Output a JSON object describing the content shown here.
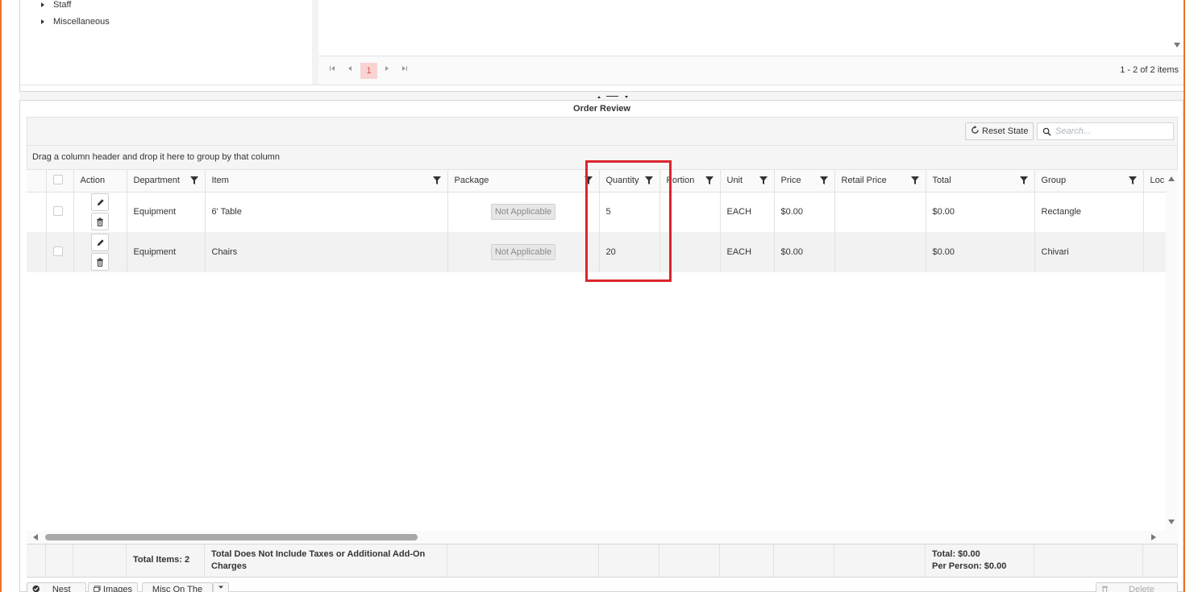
{
  "tree": {
    "items": [
      {
        "label": "Staff"
      },
      {
        "label": "Miscellaneous"
      }
    ]
  },
  "top_pager": {
    "first_icon": "first-page-icon",
    "prev_icon": "prev-page-icon",
    "current_page": "1",
    "next_icon": "next-page-icon",
    "last_icon": "last-page-icon",
    "info": "1 - 2 of 2 items"
  },
  "review": {
    "title": "Order Review",
    "reset_label": "Reset State",
    "search_placeholder": "Search...",
    "group_hint": "Drag a column header and drop it here to group by that column"
  },
  "columns": [
    {
      "key": "select",
      "label": "",
      "filter": false
    },
    {
      "key": "action",
      "label": "Action",
      "filter": false
    },
    {
      "key": "department",
      "label": "Department",
      "filter": true
    },
    {
      "key": "item",
      "label": "Item",
      "filter": true
    },
    {
      "key": "package",
      "label": "Package",
      "filter": true
    },
    {
      "key": "quantity",
      "label": "Quantity",
      "filter": true
    },
    {
      "key": "portion",
      "label": "Portion",
      "filter": true
    },
    {
      "key": "unit",
      "label": "Unit",
      "filter": true
    },
    {
      "key": "price",
      "label": "Price",
      "filter": true
    },
    {
      "key": "retail_price",
      "label": "Retail Price",
      "filter": true
    },
    {
      "key": "total",
      "label": "Total",
      "filter": true
    },
    {
      "key": "group",
      "label": "Group",
      "filter": true
    },
    {
      "key": "location",
      "label": "Loc",
      "filter": false
    }
  ],
  "rows": [
    {
      "department": "Equipment",
      "item": "6' Table",
      "package": "Not Applicable",
      "quantity": "5",
      "portion": "",
      "unit": "EACH",
      "price": "$0.00",
      "retail_price": "",
      "total": "$0.00",
      "group": "Rectangle",
      "location": ""
    },
    {
      "department": "Equipment",
      "item": "Chairs",
      "package": "Not Applicable",
      "quantity": "20",
      "portion": "",
      "unit": "EACH",
      "price": "$0.00",
      "retail_price": "",
      "total": "$0.00",
      "group": "Chivari",
      "location": ""
    }
  ],
  "footer": {
    "total_items": "Total Items: 2",
    "note": "Total Does Not Include Taxes or Additional Add-On Charges",
    "total": "Total: $0.00",
    "per_person": "Per Person: $0.00"
  },
  "bottom_bar": {
    "nest_pkgs": "Nest Pkgs",
    "images": "Images",
    "misc_on_the_fly": "Misc On The Fly",
    "delete_selected": "Delete Selected"
  },
  "colors": {
    "accent_orange": "#e8742a",
    "highlight_red": "#d9262c",
    "pager_active_bg": "#f9d2d2"
  }
}
